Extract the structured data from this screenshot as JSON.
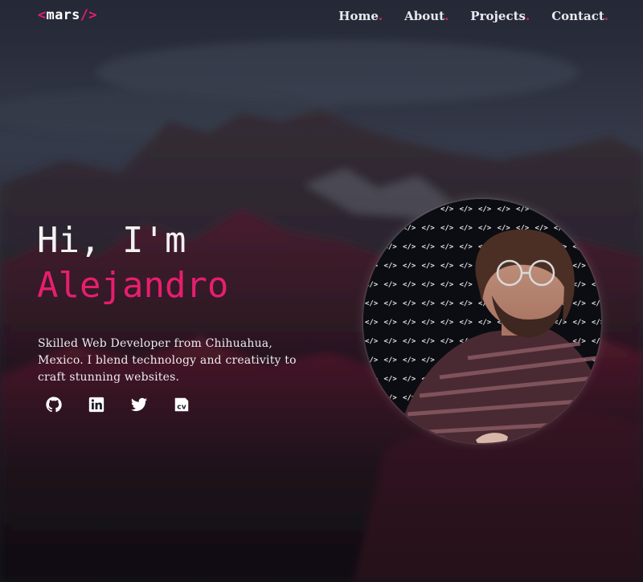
{
  "brand": {
    "open": "<",
    "name": "mars",
    "close": "/>"
  },
  "nav": {
    "items": [
      {
        "label": "Home",
        "dot": "."
      },
      {
        "label": "About",
        "dot": "."
      },
      {
        "label": "Projects",
        "dot": "."
      },
      {
        "label": "Contact",
        "dot": "."
      }
    ]
  },
  "hero": {
    "greeting": "Hi, I'm",
    "name": "Alejandro",
    "bio": "Skilled Web Developer from Chihuahua, Mexico. I blend technology and creativity to craft stunning websites."
  },
  "socials": [
    {
      "icon": "github-icon"
    },
    {
      "icon": "linkedin-icon"
    },
    {
      "icon": "twitter-icon"
    },
    {
      "icon": "cv-icon",
      "label": "cv"
    }
  ],
  "colors": {
    "accent": "#e61e6e",
    "background": "#1b1d27",
    "text": "#ececec"
  }
}
